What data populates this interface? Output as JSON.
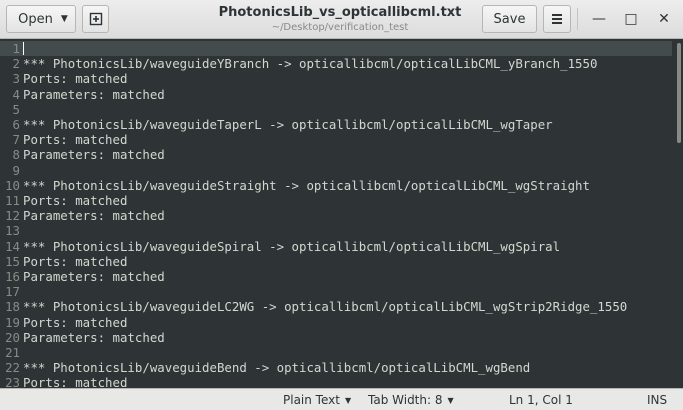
{
  "header": {
    "open_label": "Open",
    "title": "PhotonicsLib_vs_opticallibcml.txt",
    "subtitle": "~/Desktop/verification_test",
    "save_label": "Save",
    "minimize_glyph": "—",
    "maximize_glyph": "□",
    "close_glyph": "✕"
  },
  "editor": {
    "lines": [
      {
        "n": "1",
        "text": ""
      },
      {
        "n": "2",
        "text": "*** PhotonicsLib/waveguideYBranch -> opticallibcml/opticalLibCML_yBranch_1550"
      },
      {
        "n": "3",
        "text": "Ports: matched"
      },
      {
        "n": "4",
        "text": "Parameters: matched"
      },
      {
        "n": "5",
        "text": ""
      },
      {
        "n": "6",
        "text": "*** PhotonicsLib/waveguideTaperL -> opticallibcml/opticalLibCML_wgTaper"
      },
      {
        "n": "7",
        "text": "Ports: matched"
      },
      {
        "n": "8",
        "text": "Parameters: matched"
      },
      {
        "n": "9",
        "text": ""
      },
      {
        "n": "10",
        "text": "*** PhotonicsLib/waveguideStraight -> opticallibcml/opticalLibCML_wgStraight"
      },
      {
        "n": "11",
        "text": "Ports: matched"
      },
      {
        "n": "12",
        "text": "Parameters: matched"
      },
      {
        "n": "13",
        "text": ""
      },
      {
        "n": "14",
        "text": "*** PhotonicsLib/waveguideSpiral -> opticallibcml/opticalLibCML_wgSpiral"
      },
      {
        "n": "15",
        "text": "Ports: matched"
      },
      {
        "n": "16",
        "text": "Parameters: matched"
      },
      {
        "n": "17",
        "text": ""
      },
      {
        "n": "18",
        "text": "*** PhotonicsLib/waveguideLC2WG -> opticallibcml/opticalLibCML_wgStrip2Ridge_1550"
      },
      {
        "n": "19",
        "text": "Ports: matched"
      },
      {
        "n": "20",
        "text": "Parameters: matched"
      },
      {
        "n": "21",
        "text": ""
      },
      {
        "n": "22",
        "text": "*** PhotonicsLib/waveguideBend -> opticallibcml/opticalLibCML_wgBend"
      },
      {
        "n": "23",
        "text": "Ports: matched"
      }
    ]
  },
  "statusbar": {
    "language": "Plain Text",
    "tab_width": "Tab Width: 8",
    "position": "Ln 1, Col 1",
    "mode": "INS"
  }
}
